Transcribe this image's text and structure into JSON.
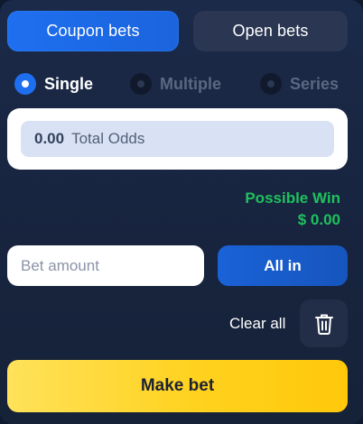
{
  "tabs": [
    {
      "label": "Coupon bets",
      "active": true
    },
    {
      "label": "Open bets",
      "active": false
    }
  ],
  "bet_types": [
    {
      "label": "Single",
      "selected": true
    },
    {
      "label": "Multiple",
      "selected": false
    },
    {
      "label": "Series",
      "selected": false
    }
  ],
  "odds": {
    "value": "0.00",
    "label": "Total Odds"
  },
  "possible_win": {
    "label": "Possible Win",
    "amount": "$ 0.00"
  },
  "amount": {
    "placeholder": "Bet amount",
    "value": ""
  },
  "all_in_label": "All in",
  "clear_all_label": "Clear all",
  "make_bet_label": "Make bet",
  "icons": {
    "delete": "trash-icon"
  },
  "colors": {
    "accent_blue": "#1e6ff0",
    "win_green": "#1fc15e",
    "cta_yellow": "#ffd21f",
    "panel_bg": "#182540"
  }
}
